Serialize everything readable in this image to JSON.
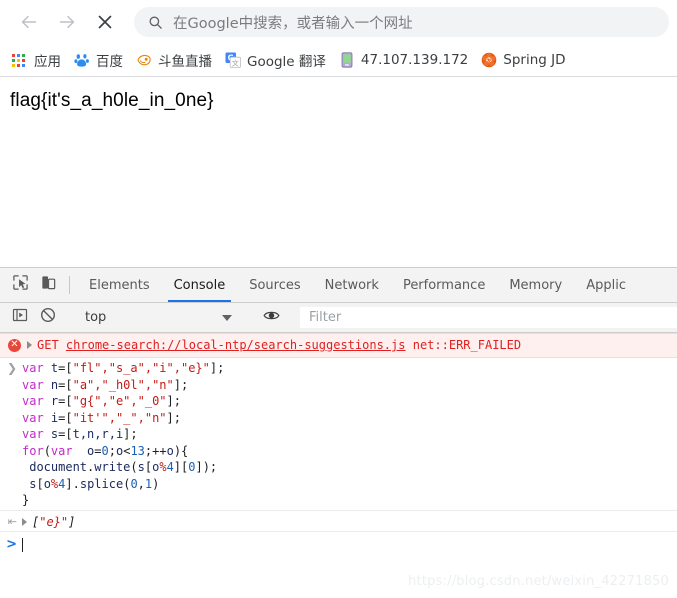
{
  "browser": {
    "nav": {
      "back_icon": "arrow-left-icon",
      "forward_icon": "arrow-right-icon",
      "stop_icon": "close-x-icon"
    },
    "omnibox": {
      "search_icon": "search-icon",
      "placeholder": "在Google中搜索，或者输入一个网址",
      "value": ""
    },
    "bookmarks": [
      {
        "label": "应用",
        "icon": "apps-grid-icon",
        "icon_color": "#4285f4"
      },
      {
        "label": "百度",
        "icon": "baidu-paw-icon",
        "icon_color": "#2d8cf0"
      },
      {
        "label": "斗鱼直播",
        "icon": "douyu-fish-icon",
        "icon_color": "#ff7a1a"
      },
      {
        "label": "Google 翻译",
        "icon": "google-translate-icon",
        "icon_color": "#4285f4"
      },
      {
        "label": "47.107.139.172",
        "icon": "device-pda-icon",
        "icon_color": "#9b8ec4"
      },
      {
        "label": "Spring JD",
        "icon": "spring-flower-icon",
        "icon_color": "#e8590c"
      }
    ]
  },
  "page": {
    "flag_text": "flag{it's_a_h0le_in_0ne}"
  },
  "devtools": {
    "toolbar_icons": {
      "inspect": "inspect-cursor-icon",
      "device": "device-toolbar-icon"
    },
    "tabs": [
      {
        "label": "Elements",
        "active": false
      },
      {
        "label": "Console",
        "active": true
      },
      {
        "label": "Sources",
        "active": false
      },
      {
        "label": "Network",
        "active": false
      },
      {
        "label": "Performance",
        "active": false
      },
      {
        "label": "Memory",
        "active": false
      },
      {
        "label": "Applic",
        "active": false
      }
    ],
    "console_toolbar": {
      "sidebar_icon": "console-sidebar-icon",
      "clear_icon": "clear-console-icon",
      "context_value": "top",
      "context_caret": "chevron-down-icon",
      "eye_icon": "live-expression-eye-icon",
      "filter_placeholder": "Filter",
      "filter_value": ""
    },
    "error_entry": {
      "badge_icon": "error-badge-icon",
      "expand_icon": "triangle-right-icon",
      "method": "GET",
      "url": "chrome-search://local-ntp/search-suggestions.js",
      "status": "net::ERR_FAILED"
    },
    "input_entry": {
      "prompt_icon": "input-chevron-icon",
      "code_lines": [
        [
          {
            "t": "var ",
            "c": "kw"
          },
          {
            "t": "t",
            "c": "id"
          },
          {
            "t": "=[",
            "c": "pl"
          },
          {
            "t": "\"fl\",\"s_a\",\"i\",\"e}\"",
            "c": "str"
          },
          {
            "t": "];",
            "c": "pl"
          }
        ],
        [
          {
            "t": "var ",
            "c": "kw"
          },
          {
            "t": "n",
            "c": "id"
          },
          {
            "t": "=[",
            "c": "pl"
          },
          {
            "t": "\"a\",\"_h0l\",\"n\"",
            "c": "str"
          },
          {
            "t": "];",
            "c": "pl"
          }
        ],
        [
          {
            "t": "var ",
            "c": "kw"
          },
          {
            "t": "r",
            "c": "id"
          },
          {
            "t": "=[",
            "c": "pl"
          },
          {
            "t": "\"g{\",\"e\",\"_0\"",
            "c": "str"
          },
          {
            "t": "];",
            "c": "pl"
          }
        ],
        [
          {
            "t": "var ",
            "c": "kw"
          },
          {
            "t": "i",
            "c": "id"
          },
          {
            "t": "=[",
            "c": "pl"
          },
          {
            "t": "\"it'\",\"_\",\"n\"",
            "c": "str"
          },
          {
            "t": "];",
            "c": "pl"
          }
        ],
        [
          {
            "t": "var ",
            "c": "kw"
          },
          {
            "t": "s",
            "c": "id"
          },
          {
            "t": "=[",
            "c": "pl"
          },
          {
            "t": "t,n,r,i",
            "c": "id"
          },
          {
            "t": "];",
            "c": "pl"
          }
        ],
        [
          {
            "t": "for",
            "c": "kw"
          },
          {
            "t": "(",
            "c": "pl"
          },
          {
            "t": "var ",
            "c": "kw"
          },
          {
            "t": " o",
            "c": "id"
          },
          {
            "t": "=",
            "c": "pl"
          },
          {
            "t": "0",
            "c": "num"
          },
          {
            "t": ";",
            "c": "pl"
          },
          {
            "t": "o",
            "c": "id"
          },
          {
            "t": "<",
            "c": "pl"
          },
          {
            "t": "13",
            "c": "num"
          },
          {
            "t": ";++",
            "c": "pl"
          },
          {
            "t": "o",
            "c": "id"
          },
          {
            "t": "){",
            "c": "pl"
          }
        ],
        [
          {
            "t": " document",
            "c": "id"
          },
          {
            "t": ".",
            "c": "pl"
          },
          {
            "t": "write",
            "c": "id"
          },
          {
            "t": "(",
            "c": "pl"
          },
          {
            "t": "s",
            "c": "id"
          },
          {
            "t": "[",
            "c": "pl"
          },
          {
            "t": "o",
            "c": "id"
          },
          {
            "t": "%",
            "c": "str"
          },
          {
            "t": "4",
            "c": "num"
          },
          {
            "t": "][",
            "c": "pl"
          },
          {
            "t": "0",
            "c": "num"
          },
          {
            "t": "]);",
            "c": "pl"
          }
        ],
        [
          {
            "t": " s",
            "c": "id"
          },
          {
            "t": "[",
            "c": "pl"
          },
          {
            "t": "o",
            "c": "id"
          },
          {
            "t": "%",
            "c": "str"
          },
          {
            "t": "4",
            "c": "num"
          },
          {
            "t": "].",
            "c": "pl"
          },
          {
            "t": "splice",
            "c": "id"
          },
          {
            "t": "(",
            "c": "pl"
          },
          {
            "t": "0",
            "c": "num"
          },
          {
            "t": ",",
            "c": "pl"
          },
          {
            "t": "1",
            "c": "num"
          },
          {
            "t": ")",
            "c": "pl"
          }
        ],
        [
          {
            "t": "}",
            "c": "pl"
          }
        ]
      ]
    },
    "result_entry": {
      "return_icon": "return-arrow-icon",
      "expand_icon": "triangle-right-icon",
      "prefix": "[",
      "value": "\"e}\"",
      "suffix": "]"
    },
    "prompt": {
      "caret": ">",
      "value": ""
    }
  },
  "watermark": {
    "text": "https://blog.csdn.net/weixin_42271850"
  }
}
